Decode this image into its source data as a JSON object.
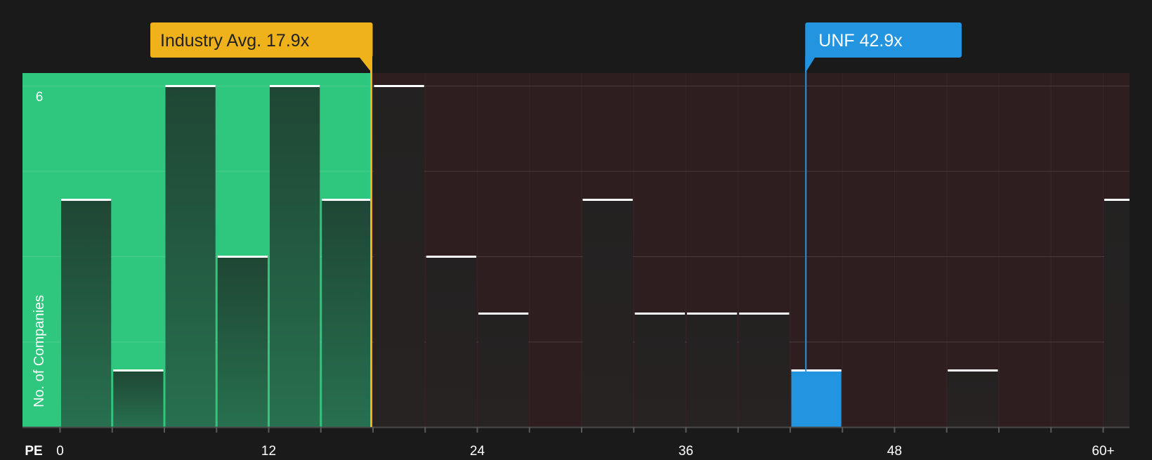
{
  "chart_data": {
    "type": "bar",
    "xlabel": "PE",
    "ylabel": "No. of Companies",
    "x_tick_labels": [
      "0",
      "12",
      "24",
      "36",
      "48",
      "60+"
    ],
    "x_tick_values": [
      0,
      12,
      24,
      36,
      48,
      60
    ],
    "y_tick_labels": [
      "6"
    ],
    "ylim": [
      0,
      6
    ],
    "xlim": [
      -2.2,
      61.5
    ],
    "bin_width": 3,
    "bins": [
      {
        "start": 0,
        "count": 4
      },
      {
        "start": 3,
        "count": 1
      },
      {
        "start": 6,
        "count": 6
      },
      {
        "start": 9,
        "count": 3
      },
      {
        "start": 12,
        "count": 6
      },
      {
        "start": 15,
        "count": 4
      },
      {
        "start": 18,
        "count": 6
      },
      {
        "start": 21,
        "count": 3
      },
      {
        "start": 24,
        "count": 2
      },
      {
        "start": 27,
        "count": 0
      },
      {
        "start": 30,
        "count": 4
      },
      {
        "start": 33,
        "count": 2
      },
      {
        "start": 36,
        "count": 2
      },
      {
        "start": 39,
        "count": 2
      },
      {
        "start": 42,
        "count": 1
      },
      {
        "start": 45,
        "count": 0
      },
      {
        "start": 48,
        "count": 0
      },
      {
        "start": 51,
        "count": 1
      },
      {
        "start": 54,
        "count": 0
      },
      {
        "start": 57,
        "count": 0
      },
      {
        "start": 60,
        "count": 4
      }
    ],
    "highlight_bin_start": 42,
    "industry_avg": {
      "label": "Industry Avg.",
      "value": 17.9,
      "display": "17.9x"
    },
    "company": {
      "ticker": "UNF",
      "value": 42.9,
      "display": "42.9x"
    },
    "grid": true,
    "colors": {
      "background": "#1a1a1a",
      "below_avg_region": "#2ec77d",
      "above_avg_region": "#2e1e1f",
      "bar_in_green": "#23523c",
      "bar_in_red": "#242222",
      "bar_cap": "#ffffff",
      "highlight_bar": "#2394e0",
      "avg_line": "#f0b21b",
      "company_line": "#2394e0",
      "text": "#ffffff",
      "avg_label_text": "#222222"
    }
  }
}
